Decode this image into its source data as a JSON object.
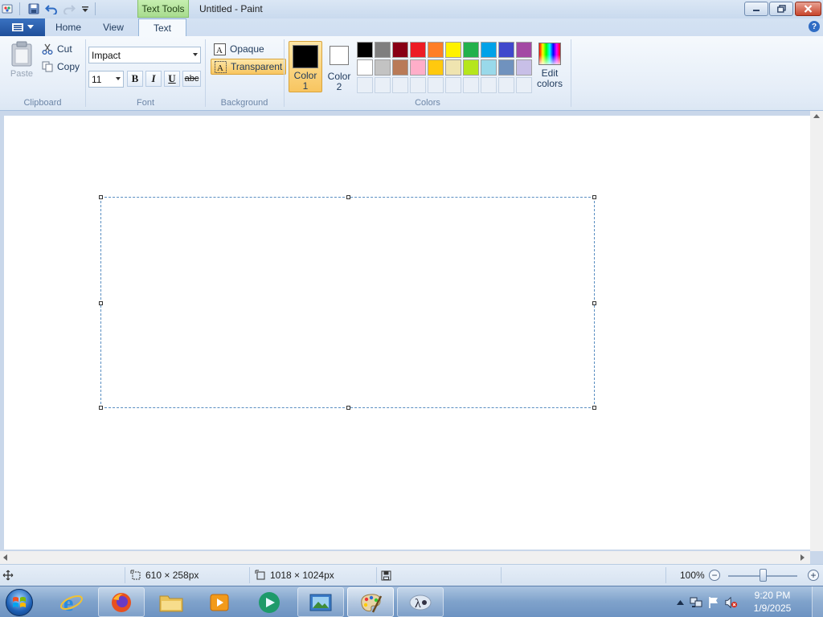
{
  "window": {
    "title": "Untitled - Paint",
    "context_tab": "Text Tools"
  },
  "tabs": {
    "home": "Home",
    "view": "View",
    "text": "Text"
  },
  "ribbon": {
    "clipboard": {
      "label": "Clipboard",
      "paste": "Paste",
      "cut": "Cut",
      "copy": "Copy"
    },
    "font": {
      "label": "Font",
      "family": "Impact",
      "size": "11",
      "bold": "B",
      "italic": "I",
      "underline": "U",
      "strike": "abc"
    },
    "background": {
      "label": "Background",
      "opaque": "Opaque",
      "transparent": "Transparent"
    },
    "colors": {
      "label": "Colors",
      "color1_label": "Color 1",
      "color1_line1": "Color",
      "color1_line2": "1",
      "color2_label": "Color 2",
      "color2_line1": "Color",
      "color2_line2": "2",
      "color1_value": "#000000",
      "color2_value": "#ffffff",
      "edit_line1": "Edit",
      "edit_line2": "colors",
      "palette_row1": [
        "#000000",
        "#7f7f7f",
        "#880015",
        "#ed1c24",
        "#ff7f27",
        "#fff200",
        "#22b14c",
        "#00a2e8",
        "#3f48cc",
        "#a349a4"
      ],
      "palette_row2": [
        "#ffffff",
        "#c3c3c3",
        "#b97a57",
        "#ffaec9",
        "#ffc90e",
        "#efe4b0",
        "#b5e61d",
        "#99d9ea",
        "#7092be",
        "#c8bfe7"
      ]
    }
  },
  "status": {
    "selection_size": "610 × 258px",
    "canvas_size": "1018 × 1024px",
    "zoom": "100%",
    "zoom_level": 0.5
  },
  "taskbar": {
    "time": "9:20 PM",
    "date": "1/9/2025"
  }
}
